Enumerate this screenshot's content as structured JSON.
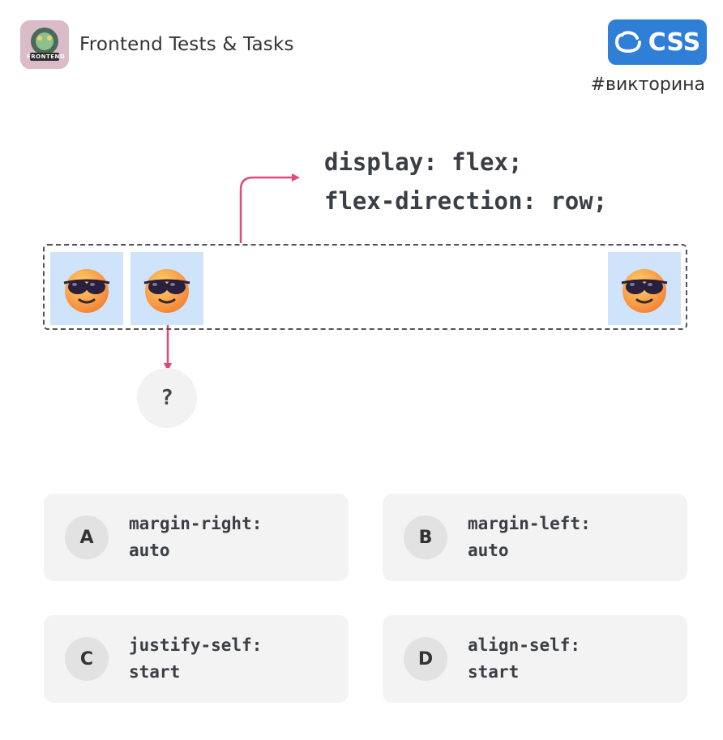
{
  "header": {
    "channel_logo_text": "FRONTEND",
    "channel_title": "Frontend Tests & Tasks",
    "badge_label": "CSS",
    "hashtag": "#викторина"
  },
  "code": {
    "line1": "display: flex;",
    "line2": "flex-direction: row;"
  },
  "diagram": {
    "items": [
      {
        "icon": "sunglasses-emoji-icon"
      },
      {
        "icon": "sunglasses-emoji-icon"
      },
      {
        "icon": "sunglasses-emoji-icon"
      }
    ],
    "question_mark": "?",
    "arrow_color": "#e0497a"
  },
  "options": [
    {
      "letter": "A",
      "line1": "margin-right:",
      "line2": "auto"
    },
    {
      "letter": "B",
      "line1": "margin-left:",
      "line2": "auto"
    },
    {
      "letter": "C",
      "line1": "justify-self:",
      "line2": "start"
    },
    {
      "letter": "D",
      "line1": "align-self:",
      "line2": "start"
    }
  ],
  "colors": {
    "badge": "#2f7fd6",
    "tile": "#cfe4fb",
    "card": "#f3f3f3"
  }
}
